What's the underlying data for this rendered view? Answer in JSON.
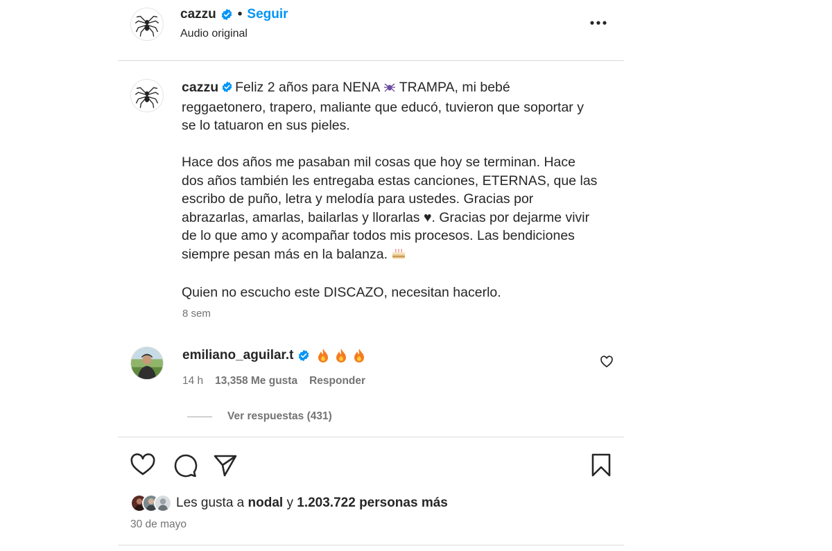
{
  "header": {
    "username": "cazzu",
    "separator": "•",
    "follow_label": "Seguir",
    "audio_label": "Audio original"
  },
  "caption": {
    "username": "cazzu",
    "line1_a": "Feliz 2 años para NENA",
    "line1_b": "TRAMPA, mi bebé reggaetonero, trapero, maliante que educó, tuvieron que soportar y se lo tatuaron en sus pieles.",
    "para2_a": "Hace dos años me pasaban mil cosas que hoy se terminan. Hace dos años también les entregaba estas canciones, ETERNAS, que las escribo de puño, letra y melodía para ustedes. Gracias por abrazarlas, amarlas, bailarlas y llorarlas",
    "heart": "♥",
    "para2_b": ". Gracias por dejarme vivir de lo que amo y acompañar todos mis procesos. Las bendiciones siempre pesan más en la balanza.",
    "para3": "Quien no escucho este DISCAZO, necesitan hacerlo.",
    "time": "8 sem"
  },
  "comment": {
    "username": "emiliano_aguilar.t",
    "time": "14 h",
    "likes": "13,358 Me gusta",
    "reply_label": "Responder",
    "view_replies": "Ver respuestas (431)"
  },
  "likes": {
    "prefix": "Les gusta a",
    "user": "nodal",
    "conj": "y",
    "count": "1.203.722 personas más"
  },
  "date": "30 de mayo",
  "colors": {
    "link_blue": "#0095f6",
    "verified_blue": "#0095f6",
    "muted_text": "#737373",
    "text": "#262626",
    "flame": "#f57c1f"
  },
  "icons": [
    "spider-avatar-icon",
    "verified-badge-icon",
    "more-options-icon",
    "spider-emoji-icon",
    "cake-emoji-icon",
    "fire-emoji-icon",
    "heart-icon",
    "comment-icon",
    "share-icon",
    "bookmark-icon"
  ]
}
